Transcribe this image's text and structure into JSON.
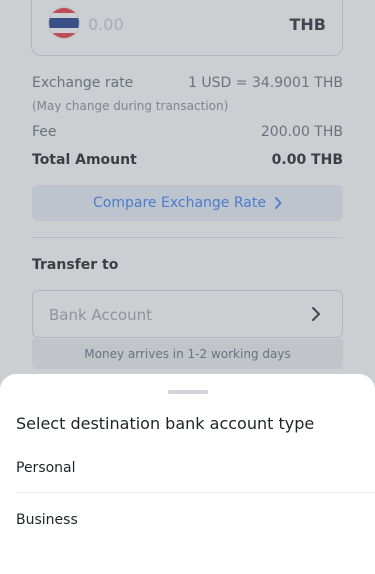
{
  "amount": {
    "placeholder": "0.00",
    "currency": "THB",
    "flag_icon": "thailand-flag-icon"
  },
  "summary": {
    "exchange_rate_label": "Exchange rate",
    "exchange_rate_value": "1 USD = 34.9001 THB",
    "exchange_note": "(May change during transaction)",
    "fee_label": "Fee",
    "fee_value": "200.00 THB",
    "total_label": "Total Amount",
    "total_value": "0.00 THB"
  },
  "compare_button": {
    "label": "Compare Exchange Rate",
    "icon": "chevron-right-icon"
  },
  "transfer": {
    "label": "Transfer to",
    "bank_placeholder": "Bank Account",
    "notice": "Money arrives in 1-2 working days"
  },
  "sheet": {
    "title": "Select destination bank account type",
    "options": [
      {
        "label": "Personal"
      },
      {
        "label": "Business"
      }
    ]
  },
  "colors": {
    "accent": "#3b82f6",
    "overlay": "rgba(110,114,122,0.35)"
  }
}
